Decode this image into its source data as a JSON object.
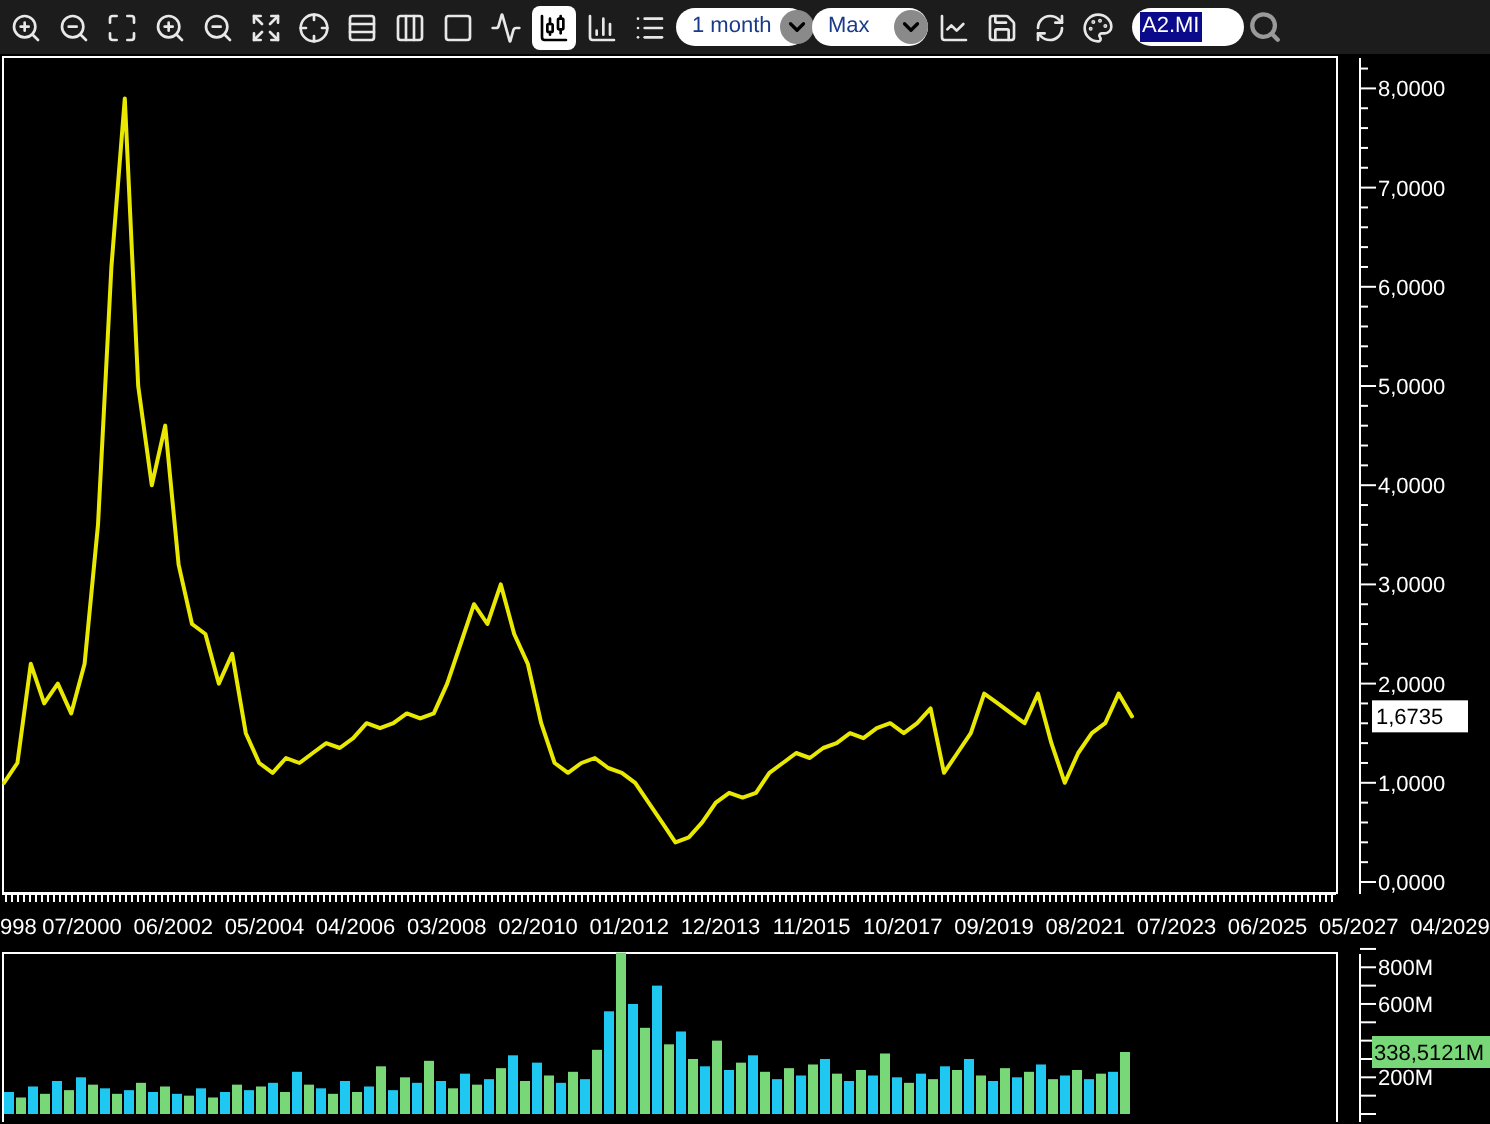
{
  "toolbar": {
    "tools_left": [
      {
        "kind": "zoom-in",
        "selected": false
      },
      {
        "kind": "zoom-out",
        "selected": false
      },
      {
        "kind": "fit",
        "selected": false
      },
      {
        "kind": "v-zoom-in",
        "selected": false
      },
      {
        "kind": "v-zoom-out",
        "selected": false
      },
      {
        "kind": "fit-all",
        "selected": false
      },
      {
        "kind": "crosshair",
        "selected": false
      },
      {
        "kind": "h-lines",
        "selected": false
      },
      {
        "kind": "v-lines",
        "selected": false
      },
      {
        "kind": "window",
        "selected": false
      },
      {
        "kind": "line",
        "selected": false
      },
      {
        "kind": "candles",
        "selected": true
      },
      {
        "kind": "bars",
        "selected": false
      },
      {
        "kind": "legend",
        "selected": false
      }
    ],
    "interval": {
      "value": "1 month"
    },
    "range": {
      "value": "Max"
    },
    "tools_right": [
      {
        "kind": "indicator"
      },
      {
        "kind": "save"
      },
      {
        "kind": "refresh"
      },
      {
        "kind": "colors"
      }
    ],
    "symbol": {
      "value": "A2.MI",
      "text_selected": true
    }
  },
  "price_chart": {
    "current_value": "1,6735",
    "y_axis_labels": [
      "8,0000",
      "7,0000",
      "6,0000",
      "5,0000",
      "4,0000",
      "3,0000",
      "2,0000",
      "1,0000",
      "0,0000"
    ],
    "x_axis_labels": [
      "998",
      "07/2000",
      "06/2002",
      "05/2004",
      "04/2006",
      "03/2008",
      "02/2010",
      "01/2012",
      "12/2013",
      "11/2015",
      "10/2017",
      "09/2019",
      "08/2021",
      "07/2023",
      "06/2025",
      "05/2027",
      "04/2029"
    ]
  },
  "volume_chart": {
    "current_value": "338,5121M",
    "y_axis_labels": [
      "800M",
      "600M",
      "200M"
    ]
  }
}
